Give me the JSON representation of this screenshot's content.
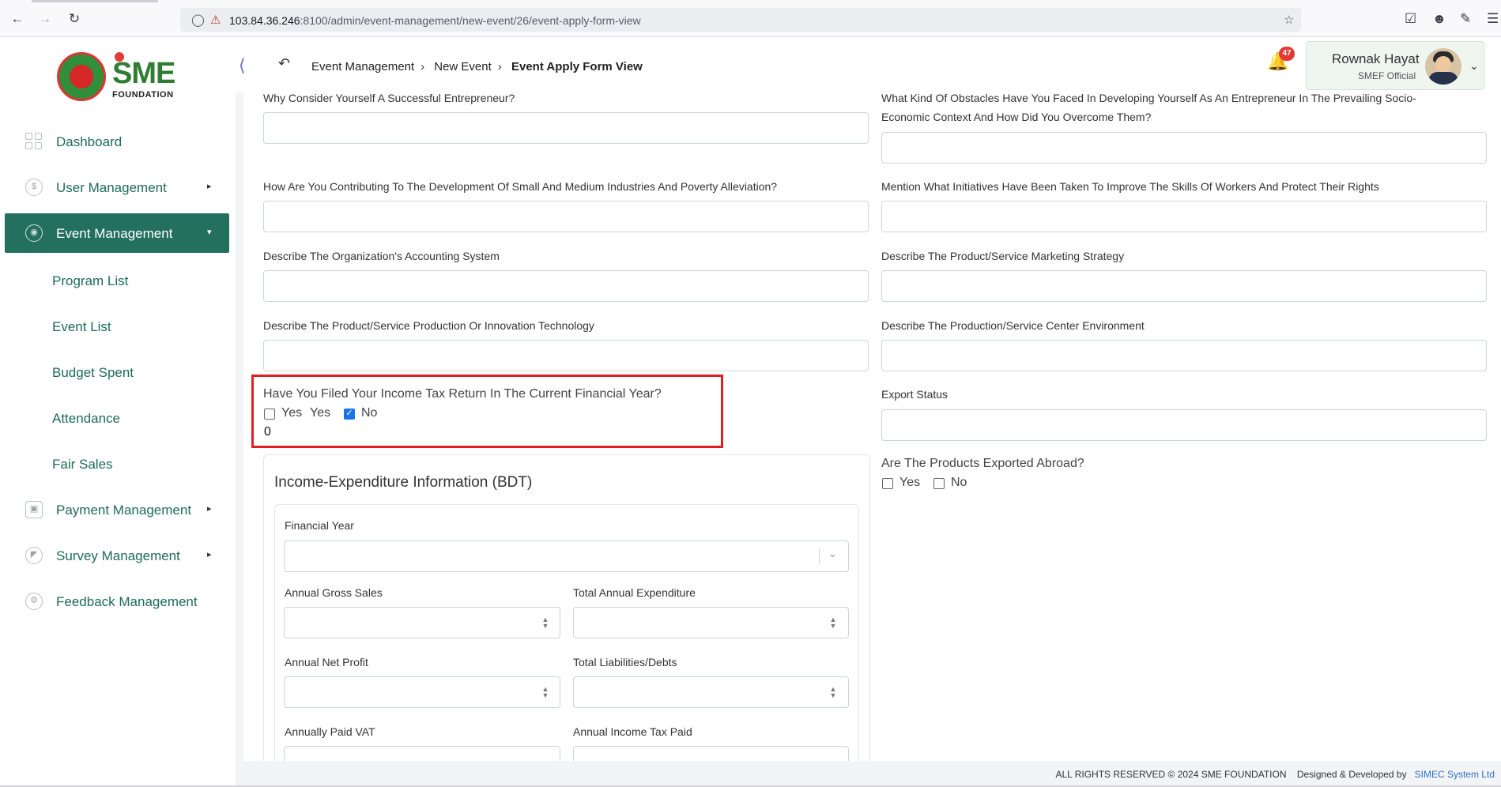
{
  "browser": {
    "url_host": "103.84.36.246",
    "url_rest": ":8100/admin/event-management/new-event/26/event-apply-form-view"
  },
  "brand": {
    "logo_text": "SME",
    "logo_sub": "FOUNDATION"
  },
  "breadcrumb": [
    "Event Management",
    "New Event",
    "Event Apply Form View"
  ],
  "notifications": {
    "count": "47"
  },
  "user": {
    "name": "Rownak Hayat",
    "role": "SMEF Official"
  },
  "sidebar": {
    "items": [
      {
        "label": "Dashboard"
      },
      {
        "label": "User Management"
      },
      {
        "label": "Event Management"
      },
      {
        "label": "Payment Management"
      },
      {
        "label": "Survey Management"
      },
      {
        "label": "Feedback Management"
      }
    ],
    "sub_items": [
      {
        "label": "Program List"
      },
      {
        "label": "Event List"
      },
      {
        "label": "Budget Spent"
      },
      {
        "label": "Attendance"
      },
      {
        "label": "Fair Sales"
      }
    ]
  },
  "form": {
    "left": {
      "q1": "Why Consider Yourself A Successful Entrepreneur?",
      "q2": "How Are You Contributing To The Development Of Small And Medium Industries And Poverty Alleviation?",
      "q3": "Describe The Organization's Accounting System",
      "q4": "Describe The Product/Service Production Or Innovation Technology"
    },
    "right": {
      "q1_line1": "What Kind Of Obstacles Have You Faced In Developing Yourself As An Entrepreneur In The Prevailing Socio-",
      "q1_line2": "Economic Context And How Did You Overcome Them?",
      "q2": "Mention What Initiatives Have Been Taken To Improve The Skills Of Workers And Protect Their Rights",
      "q3": "Describe The Product/Service Marketing Strategy",
      "q4": "Describe The Production/Service Center Environment",
      "export_status": "Export Status",
      "exported_question": "Are The Products Exported Abroad?",
      "exported_yes": "Yes",
      "exported_no": "No"
    },
    "tax": {
      "question": "Have You Filed Your Income Tax Return In The Current Financial Year?",
      "yes_label": "Yes",
      "yes_label_extra": "Yes",
      "no_label": "No",
      "no_checked": true,
      "value": "0"
    },
    "income": {
      "title": "Income-Expenditure Information (BDT)",
      "financial_year": "Financial Year",
      "annual_gross_sales": "Annual Gross Sales",
      "total_annual_expenditure": "Total Annual Expenditure",
      "annual_net_profit": "Annual Net Profit",
      "total_liabilities": "Total Liabilities/Debts",
      "annually_paid_vat": "Annually Paid VAT",
      "annual_income_tax": "Annual Income Tax Paid"
    }
  },
  "footer": {
    "rights": "ALL RIGHTS RESERVED © 2024 SME FOUNDATION",
    "designed": "Designed & Developed by",
    "developer": "SIMEC System Ltd"
  }
}
